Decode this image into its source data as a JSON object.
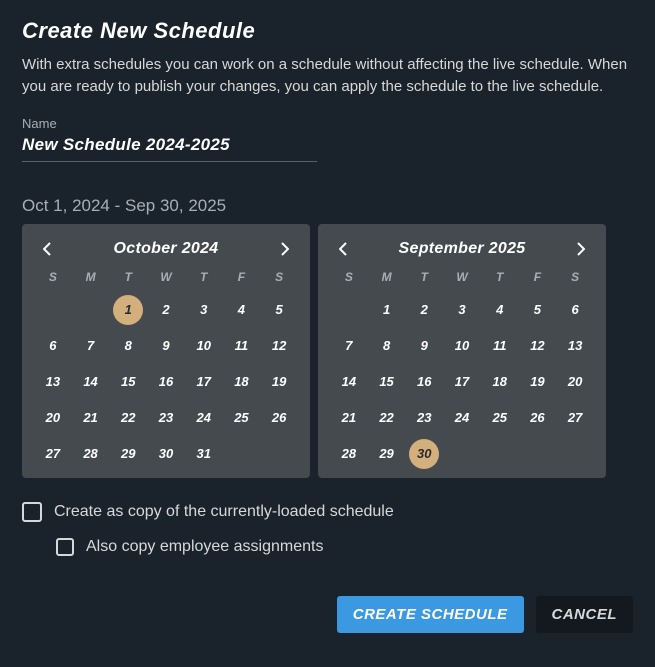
{
  "title": "Create New Schedule",
  "description": "With extra schedules you can work on a schedule without affecting the live schedule. When you are ready to publish your changes, you can apply the schedule to the live schedule.",
  "name_field": {
    "label": "Name",
    "value": "New Schedule 2024-2025"
  },
  "range_text": "Oct 1, 2024 - Sep 30, 2025",
  "dow": [
    "S",
    "M",
    "T",
    "W",
    "T",
    "F",
    "S"
  ],
  "calendar_start": {
    "title": "October 2024",
    "leading_blanks": 2,
    "days_in_month": 31,
    "selected": 1
  },
  "calendar_end": {
    "title": "September 2025",
    "leading_blanks": 1,
    "days_in_month": 30,
    "selected": 30
  },
  "options": {
    "copy_current_label": "Create as copy of the currently-loaded schedule",
    "copy_employees_label": "Also copy employee assignments"
  },
  "buttons": {
    "create": "CREATE SCHEDULE",
    "cancel": "CANCEL"
  }
}
